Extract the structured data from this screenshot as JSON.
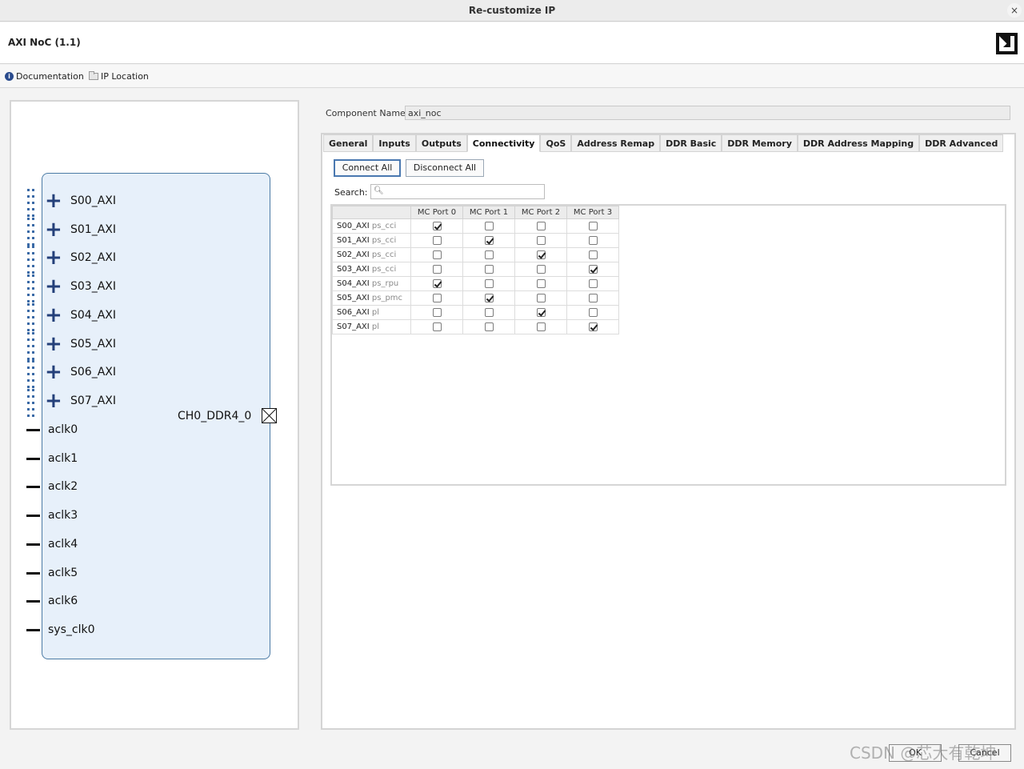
{
  "window": {
    "title": "Re-customize IP",
    "close_label": "×"
  },
  "header": {
    "ip_name": "AXI NoC (1.1)"
  },
  "links": {
    "documentation": "Documentation",
    "ip_location": "IP Location"
  },
  "symbol": {
    "bus_ports": [
      "S00_AXI",
      "S01_AXI",
      "S02_AXI",
      "S03_AXI",
      "S04_AXI",
      "S05_AXI",
      "S06_AXI",
      "S07_AXI"
    ],
    "clock_ports": [
      "aclk0",
      "aclk1",
      "aclk2",
      "aclk3",
      "aclk4",
      "aclk5",
      "aclk6",
      "sys_clk0"
    ],
    "output_port": "CH0_DDR4_0"
  },
  "component": {
    "label": "Component Name",
    "value": "axi_noc"
  },
  "tabs": [
    "General",
    "Inputs",
    "Outputs",
    "Connectivity",
    "QoS",
    "Address Remap",
    "DDR Basic",
    "DDR Memory",
    "DDR Address Mapping",
    "DDR Advanced"
  ],
  "active_tab": "Connectivity",
  "actions": {
    "connect_all": "Connect All",
    "disconnect_all": "Disconnect All"
  },
  "search": {
    "label": "Search:",
    "placeholder": ""
  },
  "grid": {
    "columns": [
      "MC Port 0",
      "MC Port 1",
      "MC Port 2",
      "MC Port 3"
    ],
    "rows": [
      {
        "port": "S00_AXI",
        "type": "ps_cci",
        "checks": [
          true,
          false,
          false,
          false
        ]
      },
      {
        "port": "S01_AXI",
        "type": "ps_cci",
        "checks": [
          false,
          true,
          false,
          false
        ]
      },
      {
        "port": "S02_AXI",
        "type": "ps_cci",
        "checks": [
          false,
          false,
          true,
          false
        ]
      },
      {
        "port": "S03_AXI",
        "type": "ps_cci",
        "checks": [
          false,
          false,
          false,
          true
        ]
      },
      {
        "port": "S04_AXI",
        "type": "ps_rpu",
        "checks": [
          true,
          false,
          false,
          false
        ]
      },
      {
        "port": "S05_AXI",
        "type": "ps_pmc",
        "checks": [
          false,
          true,
          false,
          false
        ]
      },
      {
        "port": "S06_AXI",
        "type": "pl",
        "checks": [
          false,
          false,
          true,
          false
        ]
      },
      {
        "port": "S07_AXI",
        "type": "pl",
        "checks": [
          false,
          false,
          false,
          true
        ]
      }
    ]
  },
  "footer": {
    "ok": "OK",
    "cancel": "Cancel"
  },
  "watermark": "CSDN @芯大有乾坤"
}
